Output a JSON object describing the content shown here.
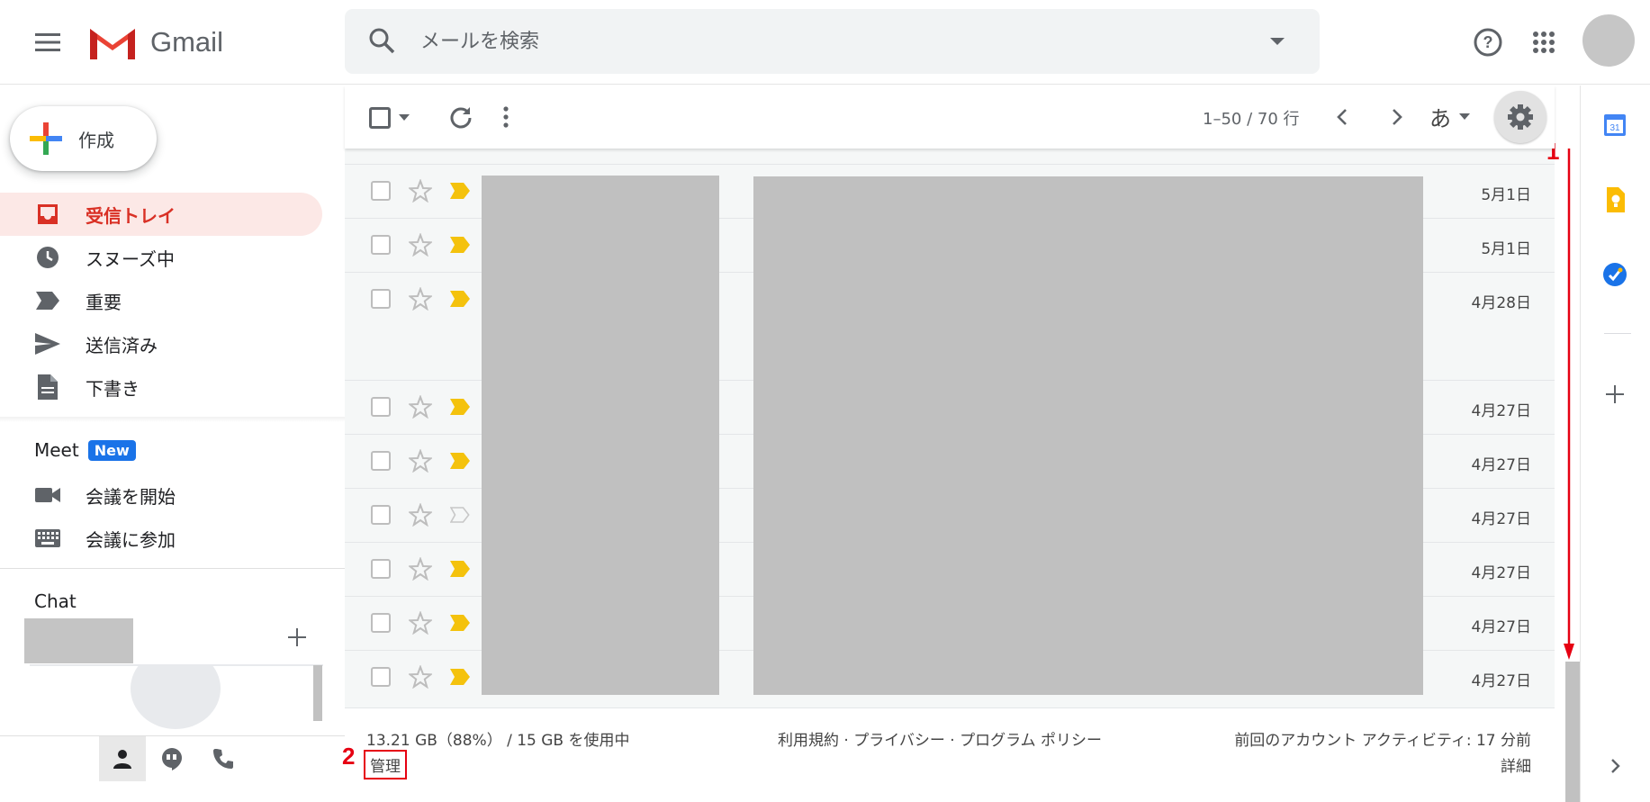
{
  "header": {
    "app_name": "Gmail",
    "search_placeholder": "メールを検索",
    "icons": [
      "menu-icon",
      "gmail-logo",
      "search-icon",
      "search-options-icon",
      "help-icon",
      "apps-icon",
      "avatar"
    ]
  },
  "sidebar": {
    "compose_label": "作成",
    "items": [
      {
        "label": "受信トレイ",
        "icon": "inbox-icon",
        "active": true
      },
      {
        "label": "スヌーズ中",
        "icon": "clock-icon",
        "active": false
      },
      {
        "label": "重要",
        "icon": "important-icon",
        "active": false
      },
      {
        "label": "送信済み",
        "icon": "send-icon",
        "active": false
      },
      {
        "label": "下書き",
        "icon": "draft-icon",
        "active": false
      }
    ],
    "meet": {
      "heading": "Meet",
      "badge": "New",
      "items": [
        {
          "label": "会議を開始",
          "icon": "video-icon"
        },
        {
          "label": "会議に参加",
          "icon": "keyboard-icon"
        }
      ]
    },
    "chat": {
      "heading": "Chat"
    }
  },
  "toolbar": {
    "page_info": "1–50 / 70 行",
    "input_tools_label": "あ"
  },
  "emails": [
    {
      "date": "5月1日",
      "important": true
    },
    {
      "date": "5月1日",
      "important": true
    },
    {
      "date": "4月28日",
      "important": true
    },
    {
      "date": "4月27日",
      "important": true
    },
    {
      "date": "4月27日",
      "important": true
    },
    {
      "date": "4月27日",
      "important": false
    },
    {
      "date": "4月27日",
      "important": true
    },
    {
      "date": "4月27日",
      "important": true
    },
    {
      "date": "4月27日",
      "important": true
    }
  ],
  "footer": {
    "storage": "13.21 GB（88%） / 15 GB を使用中",
    "manage": "管理",
    "legal": "利用規約 · プライバシー · プログラム ポリシー",
    "activity": "前回のアカウント アクティビティ: 17 分前",
    "details": "詳細"
  },
  "annotations": {
    "step1": "1",
    "step2": "2"
  },
  "colors": {
    "accent_red": "#d93025",
    "annotation_red": "#e60012",
    "important_yellow": "#f4c20d",
    "meet_blue": "#1a73e8"
  }
}
